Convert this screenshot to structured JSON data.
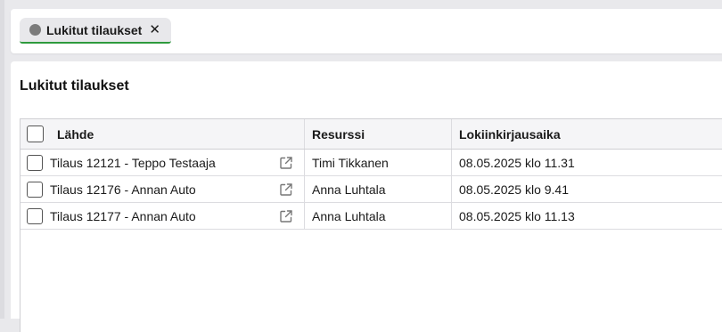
{
  "tab": {
    "label": "Lukitut tilaukset",
    "close": "✕"
  },
  "page": {
    "title": "Lukitut tilaukset"
  },
  "table": {
    "columns": [
      "Lähde",
      "Resurssi",
      "Lokiinkirjausaika"
    ],
    "rows": [
      {
        "source": "Tilaus 12121 - Teppo Testaaja",
        "resource": "Timi Tikkanen",
        "time": "08.05.2025 klo 11.31"
      },
      {
        "source": "Tilaus 12176 - Annan Auto",
        "resource": "Anna Luhtala",
        "time": "08.05.2025 klo 9.41"
      },
      {
        "source": "Tilaus 12177 - Annan Auto",
        "resource": "Anna Luhtala",
        "time": "08.05.2025 klo 11.13"
      }
    ]
  },
  "colors": {
    "accent": "#2e9a3d",
    "chip_bg": "#e8e8eb",
    "dot": "#7b7b7b"
  }
}
